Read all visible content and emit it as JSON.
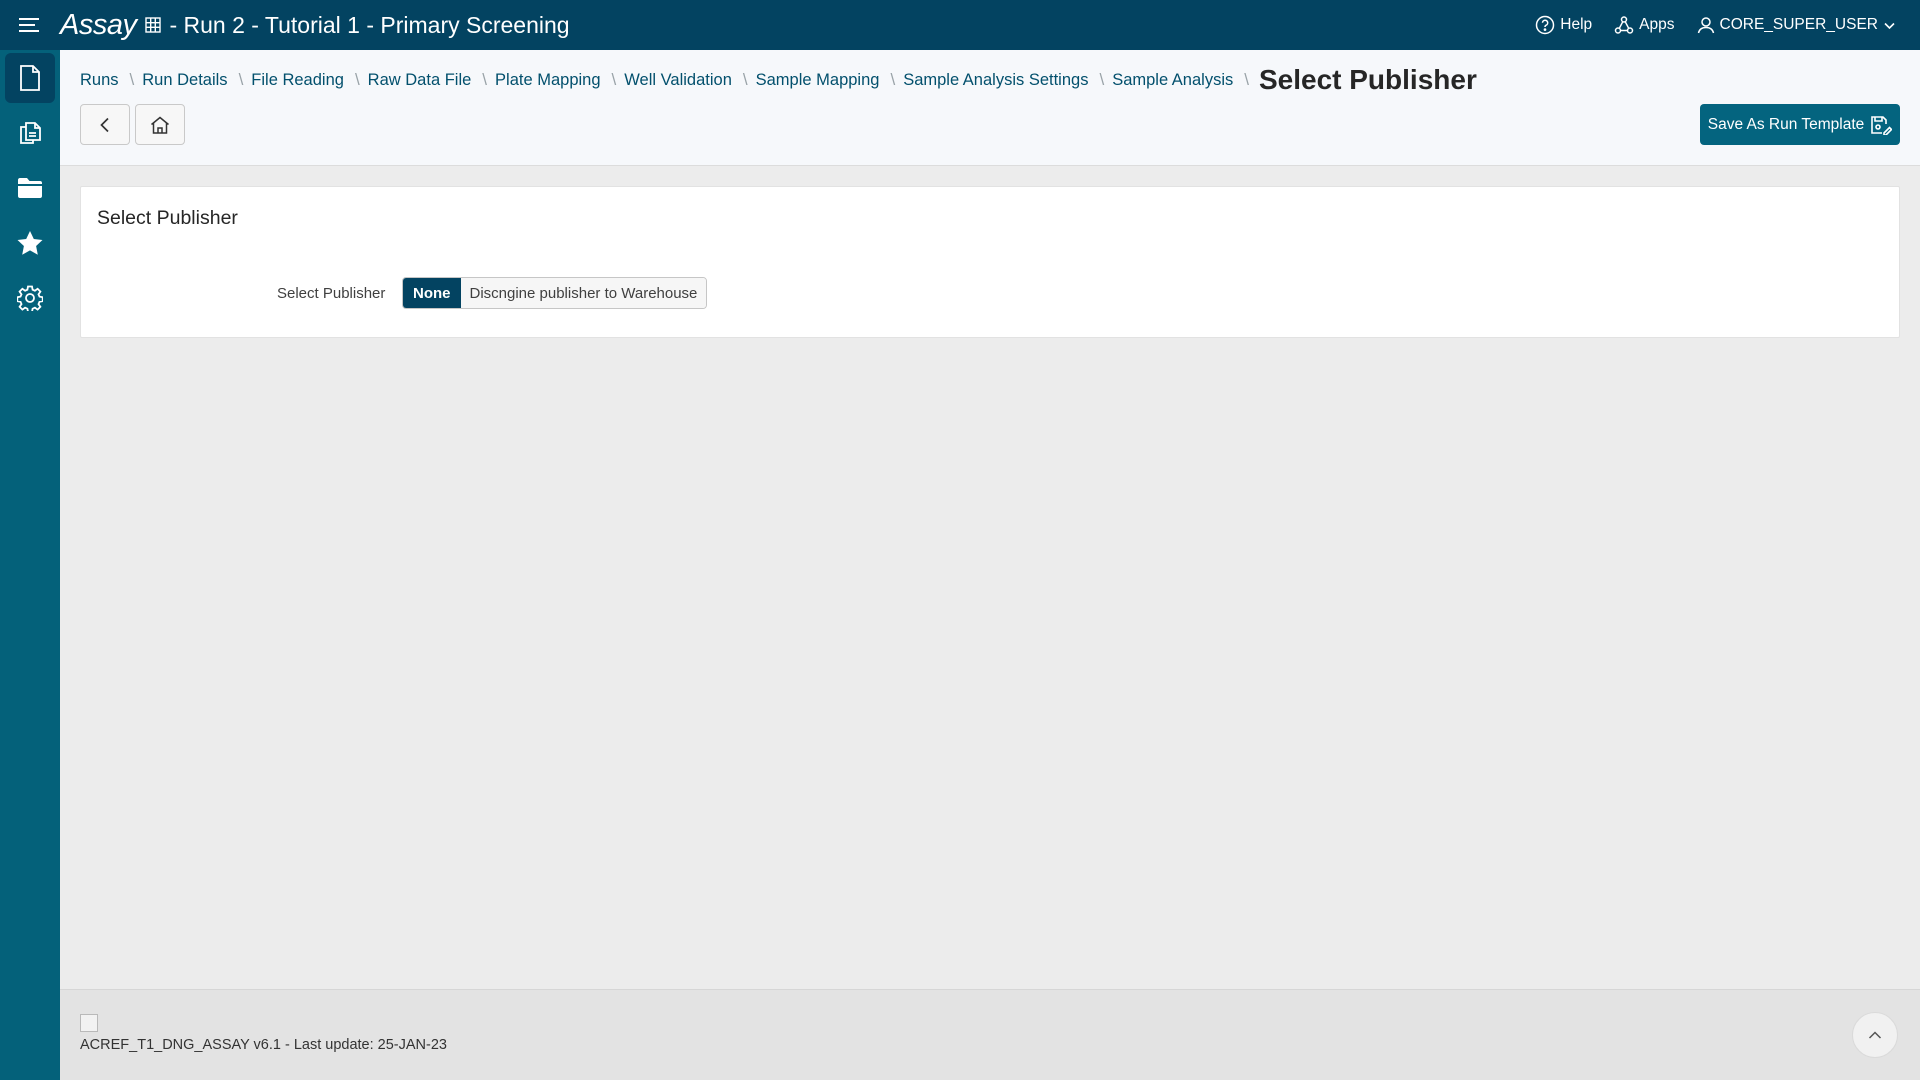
{
  "topbar": {
    "app_name": "Assay",
    "window_title": "- Run 2 - Tutorial 1 - Primary Screening",
    "help_label": "Help",
    "apps_label": "Apps",
    "user_label": "CORE_SUPER_USER"
  },
  "sidebar": {
    "items": [
      {
        "icon": "document-icon",
        "active": true
      },
      {
        "icon": "copy-documents-icon",
        "active": false
      },
      {
        "icon": "folder-icon",
        "active": false
      },
      {
        "icon": "star-icon",
        "active": false
      },
      {
        "icon": "gear-icon",
        "active": false
      }
    ]
  },
  "breadcrumb": {
    "items": [
      "Runs",
      "Run Details",
      "File Reading",
      "Raw Data File",
      "Plate Mapping",
      "Well Validation",
      "Sample Mapping",
      "Sample Analysis Settings",
      "Sample Analysis"
    ],
    "current": "Select Publisher"
  },
  "actions": {
    "save_template_label": "Save As Run Template"
  },
  "card": {
    "title": "Select Publisher",
    "field_label": "Select Publisher",
    "options": [
      "None",
      "Discngine publisher to Warehouse"
    ],
    "selected": "None"
  },
  "footer": {
    "version_text": "ACREF_T1_DNG_ASSAY v6.1 - Last update: 25-JAN-23"
  },
  "colors": {
    "topbar": "#034361",
    "sidebar": "#04617a",
    "accent": "#04647f",
    "link": "#03506d"
  }
}
